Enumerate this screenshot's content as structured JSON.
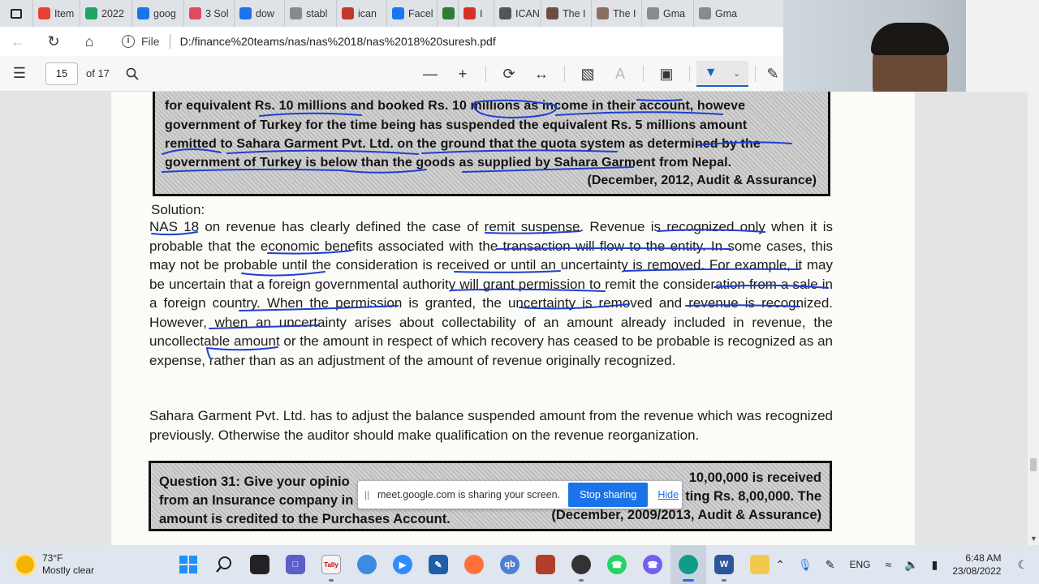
{
  "browser": {
    "tabs": [
      {
        "label": "Item",
        "icon": "gmail-icon",
        "color": "#e94235"
      },
      {
        "label": "2022",
        "icon": "drive-icon",
        "color": "#1fa463"
      },
      {
        "label": "goog",
        "icon": "search-icon",
        "color": "#1a73e8"
      },
      {
        "label": "3 Sol",
        "icon": "doc-icon",
        "color": "#e04a5f"
      },
      {
        "label": "dow",
        "icon": "search-icon",
        "color": "#1a73e8"
      },
      {
        "label": "stabl",
        "icon": "google-icon",
        "color": "#8a8a8a"
      },
      {
        "label": "ican",
        "icon": "pdf-icon",
        "color": "#c0392b"
      },
      {
        "label": "Facel",
        "icon": "facebook-icon",
        "color": "#1877f2"
      },
      {
        "label": "",
        "icon": "edit-icon",
        "color": "#2e7d32"
      },
      {
        "label": "I",
        "icon": "record-icon",
        "color": "#d93025"
      },
      {
        "label": "ICAN",
        "icon": "page-icon",
        "color": "#555555"
      },
      {
        "label": "The I",
        "icon": "site-icon",
        "color": "#6d4c41"
      },
      {
        "label": "The I",
        "icon": "site-icon",
        "color": "#8d6e63"
      },
      {
        "label": "Gma",
        "icon": "google-icon",
        "color": "#8a8a8a"
      },
      {
        "label": "Gma",
        "icon": "google-icon",
        "color": "#8a8a8a"
      }
    ],
    "address": {
      "file_label": "File",
      "url": "D:/finance%20teams/nas/nas%2018/nas%2018%20suresh.pdf"
    }
  },
  "pdf_toolbar": {
    "page_number": "15",
    "page_count": "of 17"
  },
  "document": {
    "q30_lines": [
      "for equivalent Rs. 10 millions and booked Rs. 10 millions as income in their account, howeve",
      "government of Turkey for the time being has suspended the equivalent Rs. 5 millions amount",
      "remitted to Sahara Garment Pvt. Ltd. on the ground that the quota system as determined by the",
      "government of Turkey is below than the goods as supplied by Sahara Garment from Nepal."
    ],
    "q30_ref": "(December, 2012, Audit & Assurance)",
    "solution_heading": "Solution:",
    "solution_para1": "NAS 18 on revenue has clearly defined the case of remit suspense. Revenue is recognized only when it is probable that the economic benefits associated with the transaction will flow to the entity. In some cases, this may not be probable until the consideration is received or until an uncertainty is removed. For example, it may be uncertain that a foreign governmental authority will grant permission to remit the consideration from a sale in a foreign country. When the permission is granted, the uncertainty is removed and revenue is recognized. However, when an uncertainty arises about collectability of an amount already included in revenue, the uncollectable amount or the amount in respect of which recovery has ceased to be probable is recognized as an expense, rather than as an adjustment of the amount of revenue originally recognized.",
    "solution_para2": "Sahara Garment Pvt. Ltd. has to adjust the balance suspended amount from the revenue which was recognized previously. Otherwise the auditor should make qualification on the revenue reorganization.",
    "q31_line1_left": "Question 31: Give your opinio",
    "q31_line1_right": "10,00,000 is received",
    "q31_line2_left": "from an Insurance company in",
    "q31_line2_right": "ting Rs. 8,00,000. The",
    "q31_line3_left": "amount is credited to the Purchases Account.",
    "q31_line3_right": "(December, 2009/2013, Audit & Assurance)"
  },
  "share_banner": {
    "message": "meet.google.com is sharing your screen.",
    "stop_label": "Stop sharing",
    "hide_label": "Hide"
  },
  "taskbar": {
    "weather_temp": "73°F",
    "weather_desc": "Mostly clear",
    "lang": "ENG",
    "time": "6:48 AM",
    "date": "23/08/2022"
  },
  "colors": {
    "ink": "#1e3fd0",
    "accent": "#1a73e8"
  }
}
